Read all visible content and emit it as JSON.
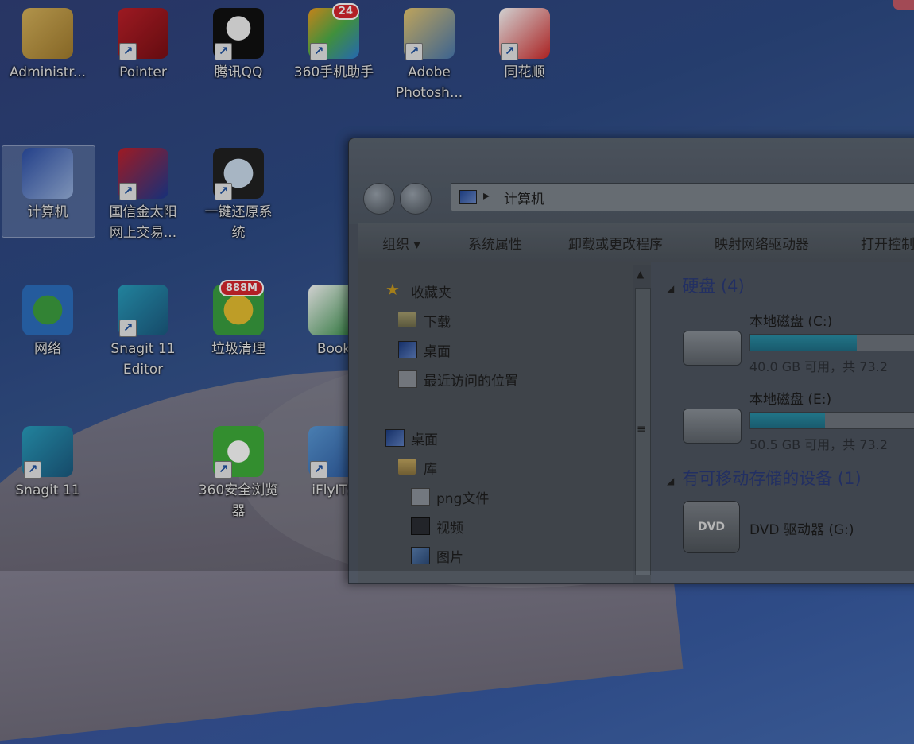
{
  "desktop": {
    "icons": [
      {
        "label": "Administr...",
        "icon": "user-folder-icon",
        "shortcut": false
      },
      {
        "label": "Pointer",
        "icon": "pointer-pen-icon",
        "shortcut": true
      },
      {
        "label": "腾讯QQ",
        "icon": "qq-penguin-icon",
        "shortcut": true
      },
      {
        "label": "360手机助手",
        "icon": "360-phone-assistant-icon",
        "shortcut": true,
        "badge": "24"
      },
      {
        "label": "Adobe\nPhotosh...",
        "icon": "photoshop-feather-icon",
        "shortcut": true
      },
      {
        "label": "同花顺",
        "icon": "playing-cards-icon",
        "shortcut": true
      },
      {
        "label": "计算机",
        "icon": "computer-icon",
        "shortcut": false,
        "selected": true
      },
      {
        "label": "国信金太阳\n网上交易...",
        "icon": "guosen-logo-icon",
        "shortcut": true
      },
      {
        "label": "一键还原系\n统",
        "icon": "restore-clock-icon",
        "shortcut": true
      },
      {
        "label": "网络",
        "icon": "network-globe-icon",
        "shortcut": false
      },
      {
        "label": "Snagit 11\nEditor",
        "icon": "snagit-editor-icon",
        "shortcut": true
      },
      {
        "label": "垃圾清理",
        "icon": "broom-cleaner-icon",
        "shortcut": false,
        "badge": "888M"
      },
      {
        "label": "Book",
        "icon": "excel-book-icon",
        "shortcut": false
      },
      {
        "label": "Snagit 11",
        "icon": "snagit-icon",
        "shortcut": true
      },
      {
        "label": "360安全浏览\n器",
        "icon": "360-browser-icon",
        "shortcut": true
      },
      {
        "label": "iFlyITS",
        "icon": "ifly-icon",
        "shortcut": true
      }
    ]
  },
  "explorer": {
    "address": {
      "location": "计算机"
    },
    "toolbar": {
      "organize": "组织 ▾",
      "system_properties": "系统属性",
      "uninstall": "卸载或更改程序",
      "map_drive": "映射网络驱动器",
      "open_control": "打开控制"
    },
    "nav": {
      "favorites": "收藏夹",
      "downloads": "下载",
      "desktop_fav": "桌面",
      "recent": "最近访问的位置",
      "desktop": "桌面",
      "libraries": "库",
      "png_files": "png文件",
      "videos": "视频",
      "pictures": "图片"
    },
    "groups": {
      "hard_disks": "硬盘 (4)",
      "removable": "有可移动存储的设备 (1)"
    },
    "drives": [
      {
        "name": "本地磁盘 (C:)",
        "free": "40.0 GB 可用，共 73.2",
        "used_fraction": 0.56
      },
      {
        "name": "本地磁盘 (E:)",
        "free": "50.5 GB 可用，共 73.2",
        "used_fraction": 0.39
      }
    ],
    "dvd": {
      "name": "DVD 驱动器 (G:)",
      "label": "DVD"
    }
  }
}
